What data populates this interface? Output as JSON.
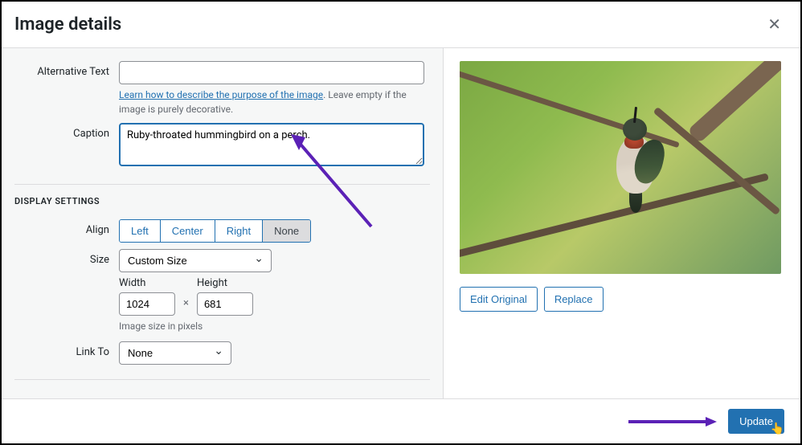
{
  "header": {
    "title": "Image details"
  },
  "fields": {
    "alt": {
      "label": "Alternative Text",
      "value": "",
      "hint_link": "Learn how to describe the purpose of the image",
      "hint_rest": ". Leave empty if the image is purely decorative."
    },
    "caption": {
      "label": "Caption",
      "value": "Ruby-throated hummingbird on a perch."
    }
  },
  "display": {
    "heading": "DISPLAY SETTINGS",
    "align": {
      "label": "Align",
      "options": [
        "Left",
        "Center",
        "Right",
        "None"
      ],
      "selected": "None"
    },
    "size": {
      "label": "Size",
      "selected": "Custom Size",
      "width_label": "Width",
      "height_label": "Height",
      "width": "1024",
      "height": "681",
      "size_hint": "Image size in pixels"
    },
    "link_to": {
      "label": "Link To",
      "selected": "None"
    }
  },
  "preview": {
    "edit_label": "Edit Original",
    "replace_label": "Replace"
  },
  "footer": {
    "update_label": "Update"
  }
}
